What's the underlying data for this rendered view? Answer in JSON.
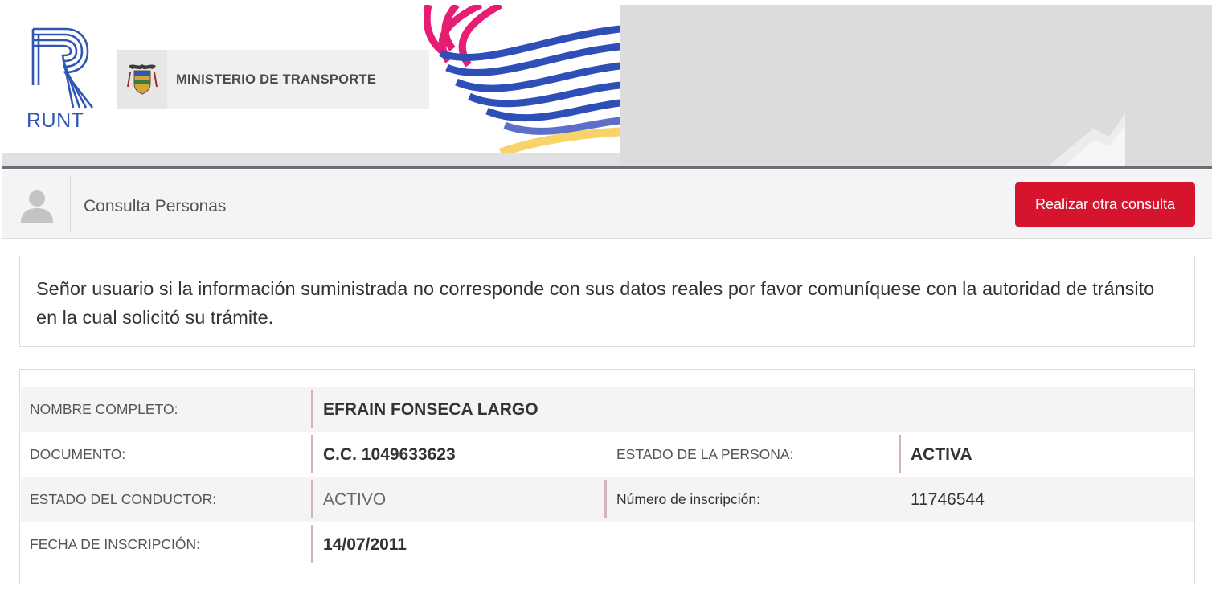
{
  "banner": {
    "brand": "RUNT",
    "ministry": "MINISTERIO DE TRANSPORTE",
    "colors": {
      "runt_blue": "#2f57b5",
      "wave_blue": "#2f4fb8",
      "wave_pink": "#e61d72",
      "wave_yellow": "#f7d36a"
    }
  },
  "header": {
    "title": "Consulta Personas",
    "action_label": "Realizar otra consulta",
    "accent": "#d6142d",
    "avatar_icon": "user-icon"
  },
  "notice": {
    "text": "Señor usuario si la información suministrada no corresponde con sus datos reales por favor comuníquese con la autoridad de tránsito en la cual solicitó su trámite."
  },
  "person": {
    "nombre_label": "NOMBRE COMPLETO:",
    "nombre_value": "EFRAIN FONSECA LARGO",
    "documento_label": "DOCUMENTO:",
    "documento_value": "C.C. 1049633623",
    "estado_persona_label": "ESTADO DE LA PERSONA:",
    "estado_persona_value": "ACTIVA",
    "estado_conductor_label": "ESTADO DEL CONDUCTOR:",
    "estado_conductor_value": "ACTIVO",
    "inscripcion_label": "Número de inscripción:",
    "inscripcion_value": "11746544",
    "fecha_label": "FECHA DE INSCRIPCIÓN:",
    "fecha_value": "14/07/2011"
  }
}
